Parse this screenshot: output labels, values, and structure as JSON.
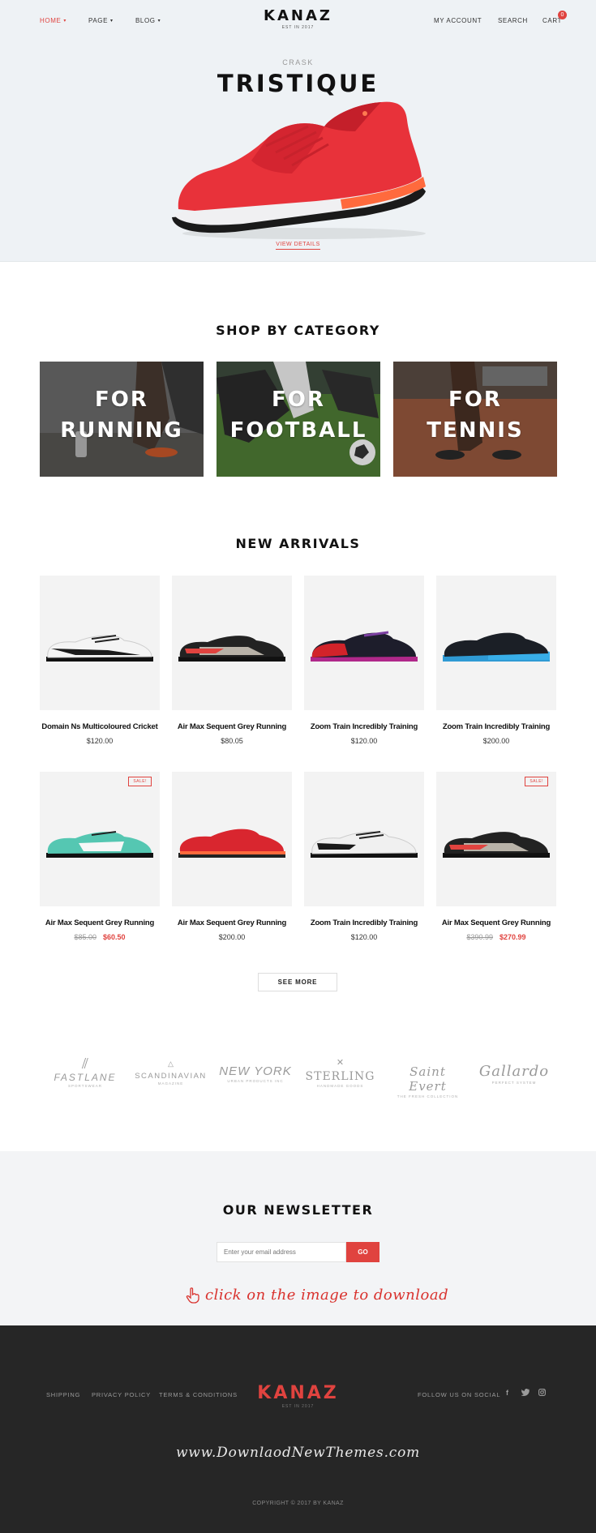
{
  "header": {
    "nav_left": [
      {
        "label": "HOME",
        "active": true
      },
      {
        "label": "PAGE",
        "active": false
      },
      {
        "label": "BLOG",
        "active": false
      }
    ],
    "logo": "KANAZ",
    "logo_tagline": "EST IN 2017",
    "nav_right": [
      "MY ACCOUNT",
      "SEARCH",
      "CART"
    ],
    "cart_count": "0"
  },
  "hero": {
    "kicker": "CRASK",
    "title": "TRISTIQUE",
    "cta": "VIEW DETAILS",
    "image_icon": "red-running-shoe"
  },
  "categories": {
    "title": "SHOP BY CATEGORY",
    "items": [
      {
        "line1": "FOR",
        "line2": "RUNNING"
      },
      {
        "line1": "FOR",
        "line2": "FOOTBALL"
      },
      {
        "line1": "FOR",
        "line2": "TENNIS"
      }
    ]
  },
  "arrivals": {
    "title": "NEW ARRIVALS",
    "products": [
      {
        "name": "Domain Ns Multicoloured Cricket",
        "price": "$120.00",
        "sale": false
      },
      {
        "name": "Air Max Sequent Grey Running",
        "price": "$80.05",
        "sale": false
      },
      {
        "name": "Zoom Train Incredibly Training",
        "price": "$120.00",
        "sale": false
      },
      {
        "name": "Zoom Train Incredibly Training",
        "price": "$200.00",
        "sale": false
      },
      {
        "name": "Air Max Sequent Grey Running",
        "old_price": "$85.00",
        "price": "$60.50",
        "sale": true,
        "badge": "SALE!"
      },
      {
        "name": "Air Max Sequent Grey Running",
        "price": "$200.00",
        "sale": false
      },
      {
        "name": "Zoom Train Incredibly Training",
        "price": "$120.00",
        "sale": false
      },
      {
        "name": "Air Max Sequent Grey Running",
        "old_price": "$390.99",
        "price": "$270.99",
        "sale": true,
        "badge": "SALE!"
      }
    ],
    "see_more": "SEE MORE"
  },
  "brands": [
    {
      "name": "FASTLANE",
      "sub": "SPORTSWEAR"
    },
    {
      "name": "SCANDINAVIAN",
      "sub": "MAGAZINE"
    },
    {
      "name": "NEW YORK",
      "sub": "URBAN PRODUCTS INC"
    },
    {
      "name": "STERLING",
      "sub": "HANDMADE GOODS"
    },
    {
      "name": "Saint Evert",
      "sub": "THE FRESH COLLECTION"
    },
    {
      "name": "Gallardo",
      "sub": "PERFECT SYSTEM"
    }
  ],
  "newsletter": {
    "title": "OUR NEWSLETTER",
    "placeholder": "Enter your email address",
    "button": "GO",
    "download_note": "click on the image to download"
  },
  "footer": {
    "links": [
      "SHIPPING",
      "PRIVACY POLICY",
      "TERMS & CONDITIONS"
    ],
    "logo": "KANAZ",
    "logo_tagline": "EST IN 2017",
    "social_label": "FOLLOW US ON SOCIAL",
    "social_icons": [
      "facebook-icon",
      "twitter-icon",
      "instagram-icon"
    ],
    "watermark": "www.DownlaodNewThemes.com",
    "copyright": "COPYRIGHT © 2017 BY KANAZ"
  },
  "colors": {
    "accent": "#e0433f",
    "hero_bg": "#eef2f5",
    "footer_bg": "#262626"
  }
}
